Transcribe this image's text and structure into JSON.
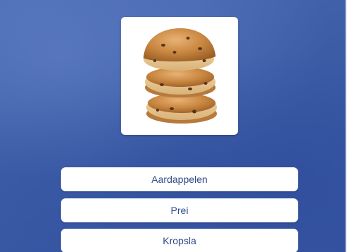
{
  "question": {
    "image_icon": "stacked-currant-buns-image"
  },
  "answers": [
    {
      "label": "Aardappelen"
    },
    {
      "label": "Prei"
    },
    {
      "label": "Kropsla"
    }
  ],
  "colors": {
    "background": "#3e5fa6",
    "card": "#ffffff",
    "button_text": "#2f4a86"
  }
}
